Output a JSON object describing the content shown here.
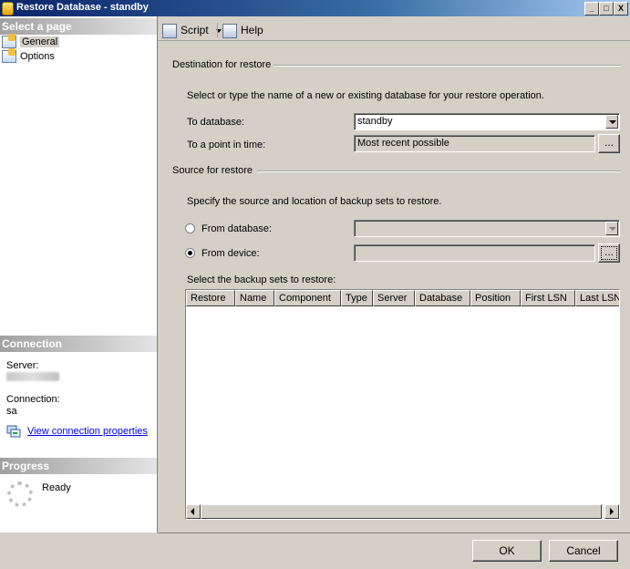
{
  "window": {
    "title": "Restore Database - standby",
    "controls": [
      "_",
      "□",
      "X"
    ]
  },
  "left": {
    "select_page": "Select a page",
    "pages": [
      {
        "label": "General",
        "selected": true
      },
      {
        "label": "Options",
        "selected": false
      }
    ],
    "connection_header": "Connection",
    "server_label": "Server:",
    "connection_label": "Connection:",
    "connection_value": "sa",
    "view_props": "View connection properties",
    "progress_header": "Progress",
    "progress_status": "Ready"
  },
  "toolbar": {
    "script": "Script",
    "help": "Help"
  },
  "destination": {
    "title": "Destination for restore",
    "hint": "Select or type the name of a new or existing database for your restore operation.",
    "to_db_label": "To database:",
    "to_db_value": "standby",
    "point_label": "To a point in time:",
    "point_value": "Most recent possible",
    "browse": "..."
  },
  "source": {
    "title": "Source for restore",
    "hint": "Specify the source and location of backup sets to restore.",
    "from_db_label": "From database:",
    "from_device_label": "From device:",
    "selected": "from_device",
    "browse": "...",
    "backup_sets_label": "Select the backup sets to restore:",
    "columns": [
      "Restore",
      "Name",
      "Component",
      "Type",
      "Server",
      "Database",
      "Position",
      "First LSN",
      "Last LSN"
    ],
    "rows": []
  },
  "buttons": {
    "ok": "OK",
    "cancel": "Cancel"
  },
  "colors": {
    "title_start": "#0a246a",
    "title_end": "#a6caf0",
    "face": "#d4d0c8",
    "link": "#0000ee"
  }
}
